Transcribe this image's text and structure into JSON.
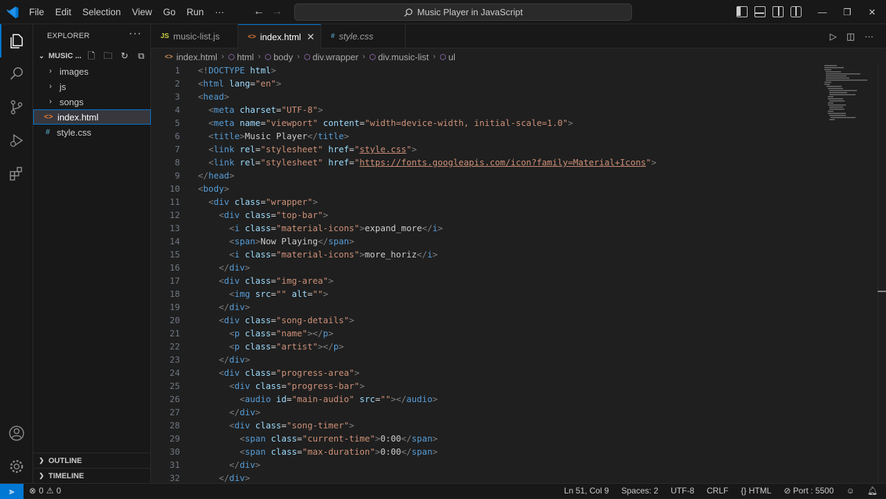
{
  "window": {
    "menu": [
      "File",
      "Edit",
      "Selection",
      "View",
      "Go",
      "Run",
      "···"
    ],
    "search": "Music Player in JavaScript"
  },
  "sidebar": {
    "title": "EXPLORER",
    "more": "···",
    "folder": "MUSIC ...",
    "tree": [
      {
        "label": "images",
        "type": "folder"
      },
      {
        "label": "js",
        "type": "folder"
      },
      {
        "label": "songs",
        "type": "folder"
      },
      {
        "label": "index.html",
        "type": "html"
      },
      {
        "label": "style.css",
        "type": "css"
      }
    ],
    "outline": "OUTLINE",
    "timeline": "TIMELINE"
  },
  "tabs": [
    {
      "label": "music-list.js",
      "icon": "JS"
    },
    {
      "label": "index.html",
      "icon": "<>"
    },
    {
      "label": "style.css",
      "icon": "#"
    }
  ],
  "breadcrumb": [
    "index.html",
    "html",
    "body",
    "div.wrapper",
    "div.music-list",
    "ul"
  ],
  "code_lines": [
    "1",
    "2",
    "3",
    "4",
    "5",
    "6",
    "7",
    "8",
    "9",
    "10",
    "11",
    "12",
    "13",
    "14",
    "15",
    "16",
    "17",
    "18",
    "19",
    "20",
    "21",
    "22",
    "23",
    "24",
    "25",
    "26",
    "27",
    "28",
    "29",
    "30",
    "31",
    "32"
  ],
  "status": {
    "problems_errors": "0",
    "problems_warnings": "0",
    "position": "Ln 51, Col 9",
    "spaces": "Spaces: 2",
    "encoding": "UTF-8",
    "eol": "CRLF",
    "language": "HTML",
    "port": "Port : 5500"
  },
  "colors": {
    "accent": "#0078d4",
    "tag": "#569cd6",
    "attr": "#9cdcfe",
    "string": "#ce9178",
    "bracket": "#808080"
  }
}
